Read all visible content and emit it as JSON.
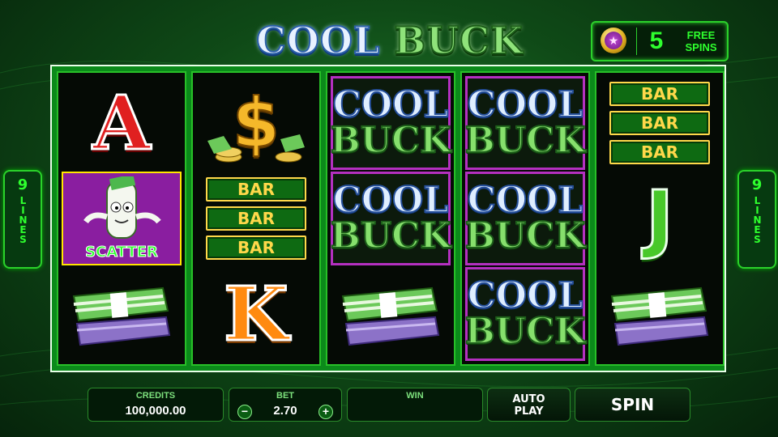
{
  "title": {
    "word1": "COOL",
    "word2": "BUCK"
  },
  "free_spins": {
    "count": "5",
    "label_line1": "FREE",
    "label_line2": "SPINS",
    "icon": "star-coin-icon"
  },
  "lines_badge": {
    "number": "9",
    "word": "LINES"
  },
  "reels": {
    "reel1": {
      "top": "A",
      "middle_label": "SCATTER",
      "bottom": "cash-stack"
    },
    "reel2": {
      "top": "$",
      "bar_labels": [
        "BAR",
        "BAR",
        "BAR"
      ],
      "bottom": "K"
    },
    "reel3": {
      "logo_line1": "COOL",
      "logo_line2": "BUCK",
      "bottom": "cash-stack"
    },
    "reel4": {
      "logo_line1": "COOL",
      "logo_line2": "BUCK"
    },
    "reel5": {
      "bar_labels": [
        "BAR",
        "BAR",
        "BAR"
      ],
      "middle": "J",
      "bottom": "cash-stack"
    }
  },
  "panel": {
    "credits_label": "CREDITS",
    "credits_value": "100,000.00",
    "bet_label": "BET",
    "bet_value": "2.70",
    "bet_minus": "−",
    "bet_plus": "+",
    "win_label": "WIN",
    "win_value": ""
  },
  "buttons": {
    "auto_line1": "AUTO",
    "auto_line2": "PLAY",
    "spin": "SPIN"
  },
  "colors": {
    "frame_green": "#0b8a1a",
    "win_highlight": "#b430c0",
    "accent": "#2eff2e"
  }
}
